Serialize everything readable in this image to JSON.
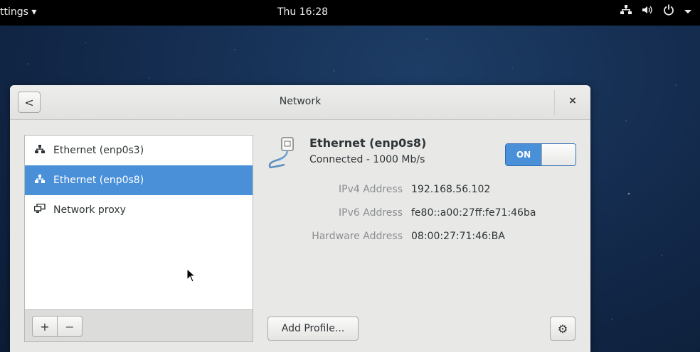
{
  "topbar": {
    "app_menu": "ttings ▾",
    "clock": "Thu 16:28",
    "tray_icons": [
      "network-icon",
      "volume-icon",
      "power-icon",
      "chevron-down-icon"
    ]
  },
  "window": {
    "title": "Network",
    "back_symbol": "<",
    "close_symbol": "×"
  },
  "sidebar": {
    "items": [
      {
        "label": "Ethernet (enp0s3)",
        "icon": "wired-network-icon",
        "selected": false
      },
      {
        "label": "Ethernet (enp0s8)",
        "icon": "wired-network-icon",
        "selected": true
      },
      {
        "label": "Network proxy",
        "icon": "network-proxy-icon",
        "selected": false
      }
    ],
    "add_symbol": "+",
    "remove_symbol": "−"
  },
  "device": {
    "name": "Ethernet (enp0s8)",
    "status": "Connected - 1000 Mb/s",
    "switch_label": "ON",
    "switch_on": true,
    "details": [
      {
        "key": "IPv4 Address",
        "value": "192.168.56.102"
      },
      {
        "key": "IPv6 Address",
        "value": "fe80::a00:27ff:fe71:46ba"
      },
      {
        "key": "Hardware Address",
        "value": "08:00:27:71:46:BA"
      }
    ],
    "add_profile_label": "Add Profile...",
    "settings_symbol": "⚙"
  },
  "colors": {
    "selection": "#4a90d9",
    "topbar": "#000000",
    "desktop": "#142c4f"
  }
}
